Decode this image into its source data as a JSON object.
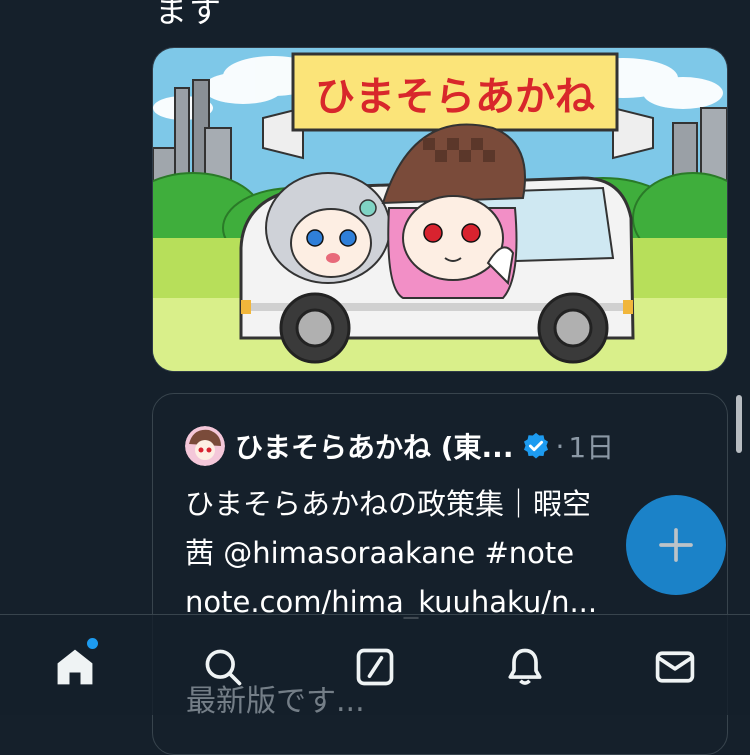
{
  "tweet": {
    "text_fragment": "ます"
  },
  "media": {
    "banner_text": "ひまそらあかね"
  },
  "quote": {
    "author": "ひまそらあかね (東...",
    "separator": "·",
    "time": "1日",
    "text": "ひまそらあかねの政策集｜暇空\n茜 @himasoraakane #note\nnote.com/hima_kuuhaku/n...",
    "next_text": "最新版です..."
  },
  "colors": {
    "background": "#15202b",
    "accent": "#1d9bf0",
    "muted": "#8b98a5"
  },
  "nav": {
    "items": [
      "home-icon",
      "search-icon",
      "grok-icon",
      "notifications-icon",
      "messages-icon"
    ],
    "active": "home",
    "unread_dot": true
  },
  "fab": {
    "icon": "plus-icon"
  }
}
